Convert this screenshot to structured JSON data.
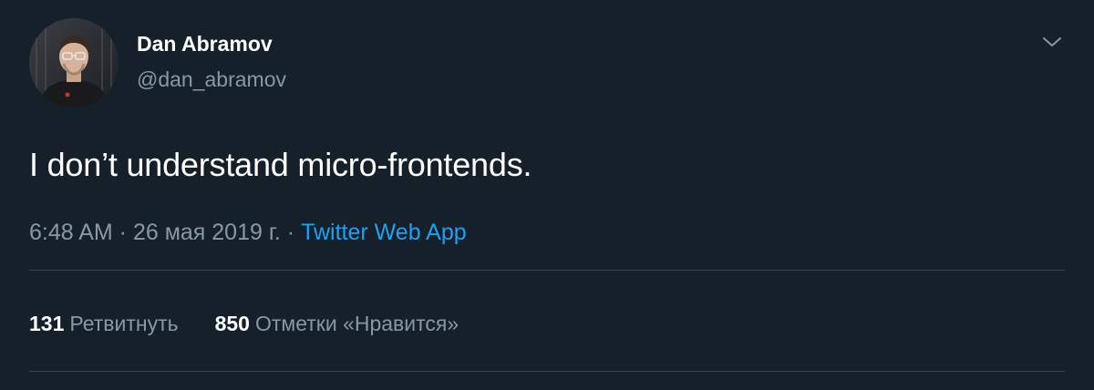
{
  "author": {
    "display_name": "Dan Abramov",
    "handle": "@dan_abramov"
  },
  "tweet": {
    "text": "I don’t understand micro-frontends.",
    "time": "6:48 AM",
    "separator": " · ",
    "date": "26 мая 2019 г.",
    "source": "Twitter Web App"
  },
  "stats": {
    "retweets_count": "131",
    "retweets_label": "Ретвитнуть",
    "likes_count": "850",
    "likes_label": "Отметки «Нравится»"
  },
  "icons": {
    "menu": "chevron-down-icon"
  },
  "colors": {
    "background": "#15202b",
    "primary_text": "#ffffff",
    "secondary_text": "#8899a6",
    "link": "#1da1f2",
    "divider": "#38444d"
  }
}
